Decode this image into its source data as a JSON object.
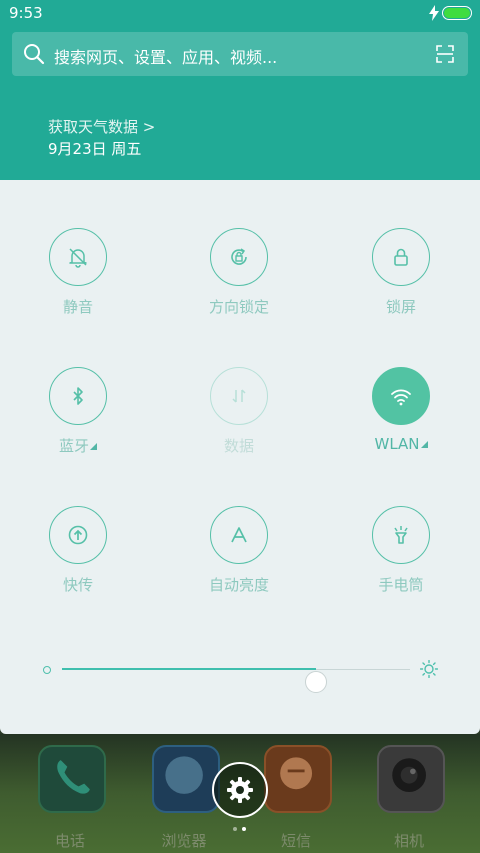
{
  "status_bar": {
    "time": "9:53",
    "charging_icon": "bolt-icon",
    "battery_icon": "battery-icon",
    "battery_color": "#3fdc3f"
  },
  "search": {
    "placeholder": "搜索网页、设置、应用、视频...",
    "icon": "search-icon",
    "scan_icon": "scan-icon"
  },
  "weather": {
    "link": "获取天气数据 >",
    "date": "9月23日 周五"
  },
  "header_color": "#21aa96",
  "accent_color": "#52c3a3",
  "toggles": [
    {
      "label": "静音",
      "icon": "bell-off-icon",
      "state": "off"
    },
    {
      "label": "方向锁定",
      "icon": "rotation-lock-icon",
      "state": "off"
    },
    {
      "label": "锁屏",
      "icon": "lock-icon",
      "state": "off"
    },
    {
      "label": "蓝牙",
      "icon": "bluetooth-icon",
      "state": "off",
      "has_menu": true
    },
    {
      "label": "数据",
      "icon": "mobile-data-icon",
      "state": "disabled"
    },
    {
      "label": "WLAN",
      "icon": "wifi-icon",
      "state": "on",
      "has_menu": true
    },
    {
      "label": "快传",
      "icon": "quick-transfer-icon",
      "state": "off"
    },
    {
      "label": "自动亮度",
      "icon": "auto-brightness-icon",
      "state": "off"
    },
    {
      "label": "手电筒",
      "icon": "flashlight-icon",
      "state": "off"
    }
  ],
  "brightness": {
    "level": 0.73,
    "low_icon": "brightness-low-icon",
    "high_icon": "brightness-high-icon"
  },
  "dock": {
    "apps": [
      {
        "label": "电话",
        "icon": "phone-icon"
      },
      {
        "label": "浏览器",
        "icon": "browser-icon"
      },
      {
        "label": "短信",
        "icon": "messages-icon"
      },
      {
        "label": "相机",
        "icon": "camera-icon"
      }
    ],
    "settings_icon": "gear-icon",
    "page_indicator": {
      "pages": 2,
      "current": 2
    }
  }
}
